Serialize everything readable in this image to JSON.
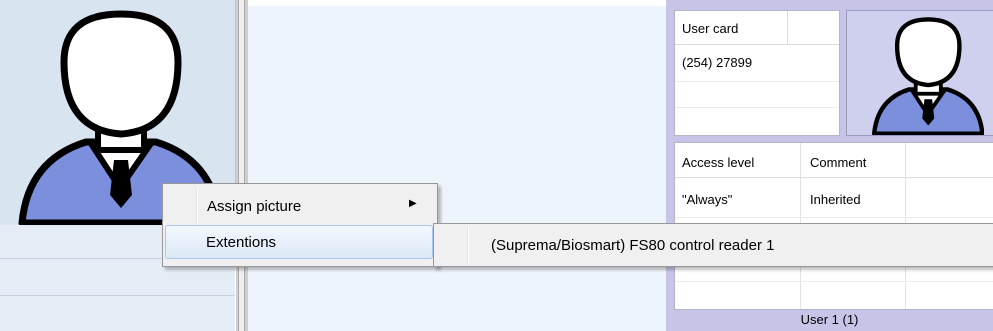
{
  "user_card": {
    "header": "User card",
    "value": "(254) 27899"
  },
  "access_table": {
    "columns": [
      "Access level",
      "Comment"
    ],
    "rows": [
      {
        "access_level": "\"Always\"",
        "comment": "Inherited"
      }
    ]
  },
  "user_label": "User 1 (1)",
  "context_menu": {
    "items": [
      {
        "label": "Assign picture",
        "has_submenu": true
      },
      {
        "label": "Extentions",
        "highlighted": true
      }
    ],
    "submenu_arrow": "▶",
    "submenu": {
      "items": [
        {
          "label": "(Suprema/Biosmart) FS80 control reader 1"
        }
      ]
    }
  },
  "icons": {
    "left_avatar": "user-avatar-icon",
    "right_avatar": "user-avatar-icon",
    "submenu_arrow": "chevron-right-icon"
  },
  "colors": {
    "avatar_shirt": "#7b8fdc",
    "menu_highlight_border": "#a9c5ea",
    "right_panel_bg": "#c6c5e8"
  }
}
